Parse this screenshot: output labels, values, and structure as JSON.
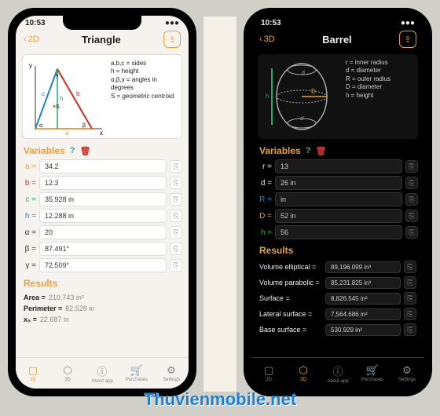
{
  "watermark": "Thuvienmobile.net",
  "left": {
    "time": "10:53",
    "back": "2D",
    "title": "Triangle",
    "legend": [
      "a,b,c = sides",
      "h = height",
      "α,β,γ = angles in",
      "degrees",
      "S = geometric centroid"
    ],
    "section_vars": "Variables",
    "vars": [
      {
        "label": "a =",
        "value": "34.2",
        "color": "#e6a23c"
      },
      {
        "label": "b =",
        "value": "12.3",
        "color": "#c33"
      },
      {
        "label": "c =",
        "value": "35.928 in",
        "color": "#2a6"
      },
      {
        "label": "h =",
        "value": "12.288 in",
        "color": "#28c"
      },
      {
        "label": "α =",
        "value": "20",
        "color": "#333"
      },
      {
        "label": "β =",
        "value": "87.491°",
        "color": "#333"
      },
      {
        "label": "γ =",
        "value": "72.509°",
        "color": "#333"
      }
    ],
    "section_res": "Results",
    "results": [
      {
        "label": "Area =",
        "value": "210.743 in²"
      },
      {
        "label": "Perimeter =",
        "value": "82.528 in"
      },
      {
        "label": "x₅ =",
        "value": "22.687 in"
      }
    ],
    "tabs": [
      {
        "label": "2D",
        "icon": "▢",
        "active": true
      },
      {
        "label": "3D",
        "icon": "⬡",
        "active": false
      },
      {
        "label": "About app",
        "icon": "ⓘ",
        "active": false
      },
      {
        "label": "Purchases",
        "icon": "🛒",
        "active": false
      },
      {
        "label": "Settings",
        "icon": "⚙",
        "active": false
      }
    ]
  },
  "right": {
    "time": "10:53",
    "back": "3D",
    "title": "Barrel",
    "legend": [
      "r = inner radius",
      "d = diameter",
      "R = outer radius",
      "D = diameter",
      "h = height"
    ],
    "section_vars": "Variables",
    "vars": [
      {
        "label": "r =",
        "value": "13",
        "color": "#eee"
      },
      {
        "label": "d =",
        "value": "26 in",
        "color": "#eee"
      },
      {
        "label": "R =",
        "value": "in",
        "color": "#28c"
      },
      {
        "label": "D =",
        "value": "52 in",
        "color": "#e6a23c"
      },
      {
        "label": "h =",
        "value": "56",
        "color": "#2a6"
      }
    ],
    "section_res": "Results",
    "results": [
      {
        "label": "Volume elliptical =",
        "value": "89,196.099 in³"
      },
      {
        "label": "Volume parabolic =",
        "value": "85,231.825 in³"
      },
      {
        "label": "Surface =",
        "value": "8,826.545 in²"
      },
      {
        "label": "Lateral surface =",
        "value": "7,564.686 in²"
      },
      {
        "label": "Base surface =",
        "value": "530.929 in²"
      }
    ],
    "tabs": [
      {
        "label": "2D",
        "icon": "▢",
        "active": false
      },
      {
        "label": "3D",
        "icon": "⬡",
        "active": true
      },
      {
        "label": "About app",
        "icon": "ⓘ",
        "active": false
      },
      {
        "label": "Purchases",
        "icon": "🛒",
        "active": false
      },
      {
        "label": "Settings",
        "icon": "⚙",
        "active": false
      }
    ]
  }
}
